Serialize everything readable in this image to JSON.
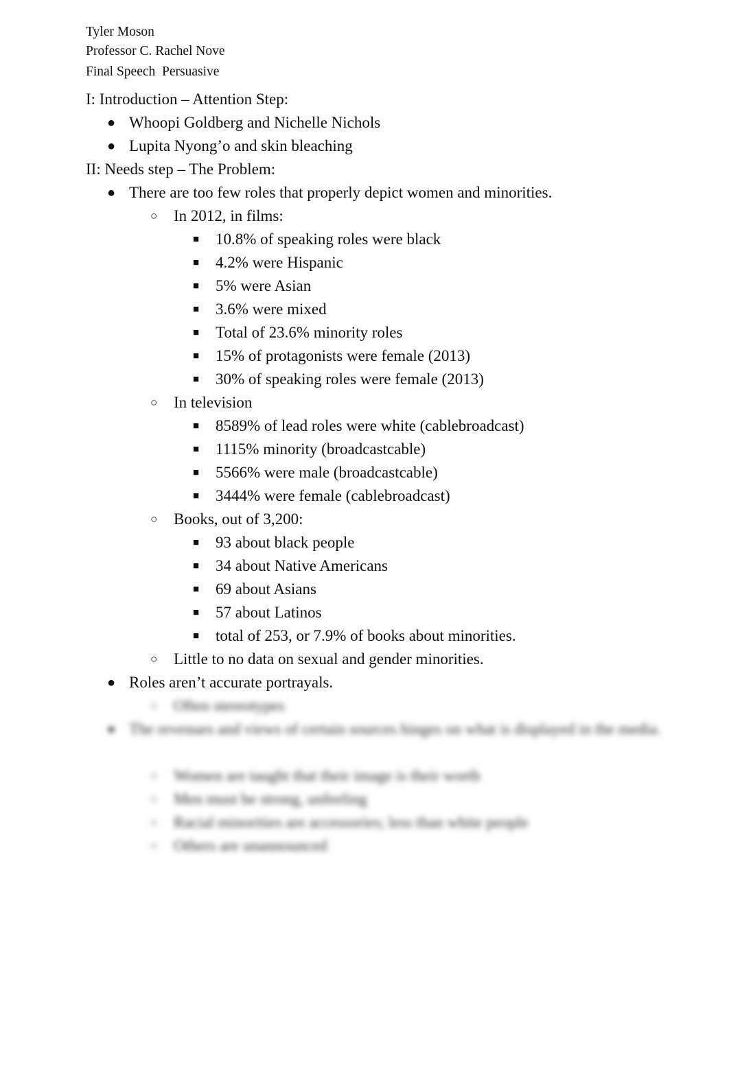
{
  "header": {
    "author": "Tyler Moson",
    "professor": "Professor C. Rachel Nove",
    "assignment": "Final Speech  Persuasive"
  },
  "markers": {
    "level1": "●",
    "level2": "○",
    "level3": "■"
  },
  "outline": {
    "section1": {
      "heading": "I: Introduction – Attention Step:",
      "items": [
        "Whoopi Goldberg and Nichelle Nichols",
        "Lupita Nyong’o and skin bleaching"
      ]
    },
    "section2": {
      "heading": "II: Needs step – The Problem:",
      "point1": {
        "text": "There are too few roles that properly depict women and minorities.",
        "films": {
          "label": "In 2012, in films:",
          "items": [
            "10.8% of speaking roles were black",
            "4.2% were Hispanic",
            "5% were Asian",
            "3.6% were mixed",
            "Total of 23.6% minority roles",
            "15% of protagonists were female (2013)",
            "30% of speaking roles were female (2013)"
          ]
        },
        "television": {
          "label": "In television",
          "items": [
            "8589% of lead roles were white (cablebroadcast)",
            "1115% minority (broadcastcable)",
            "5566% were male (broadcastcable)",
            "3444% were female (cablebroadcast)"
          ]
        },
        "books": {
          "label": "Books, out of 3,200:",
          "items": [
            "93 about black people",
            "34 about Native Americans",
            "69 about Asians",
            "57 about Latinos",
            "total of 253, or 7.9% of books about minorities."
          ]
        },
        "other": "Little to no data on sexual and gender minorities."
      },
      "point2": {
        "text": "Roles aren’t accurate portrayals.",
        "items": [
          "Often stereotypes"
        ]
      },
      "point3": {
        "text": "The revenues and views of certain sources hinges on what is displayed in the media.",
        "items": [
          "Women are taught that their image is their worth",
          "Men must be strong, unfeeling",
          "Racial minorities are accessories; less than white people",
          "Others are unannounced"
        ]
      }
    }
  }
}
